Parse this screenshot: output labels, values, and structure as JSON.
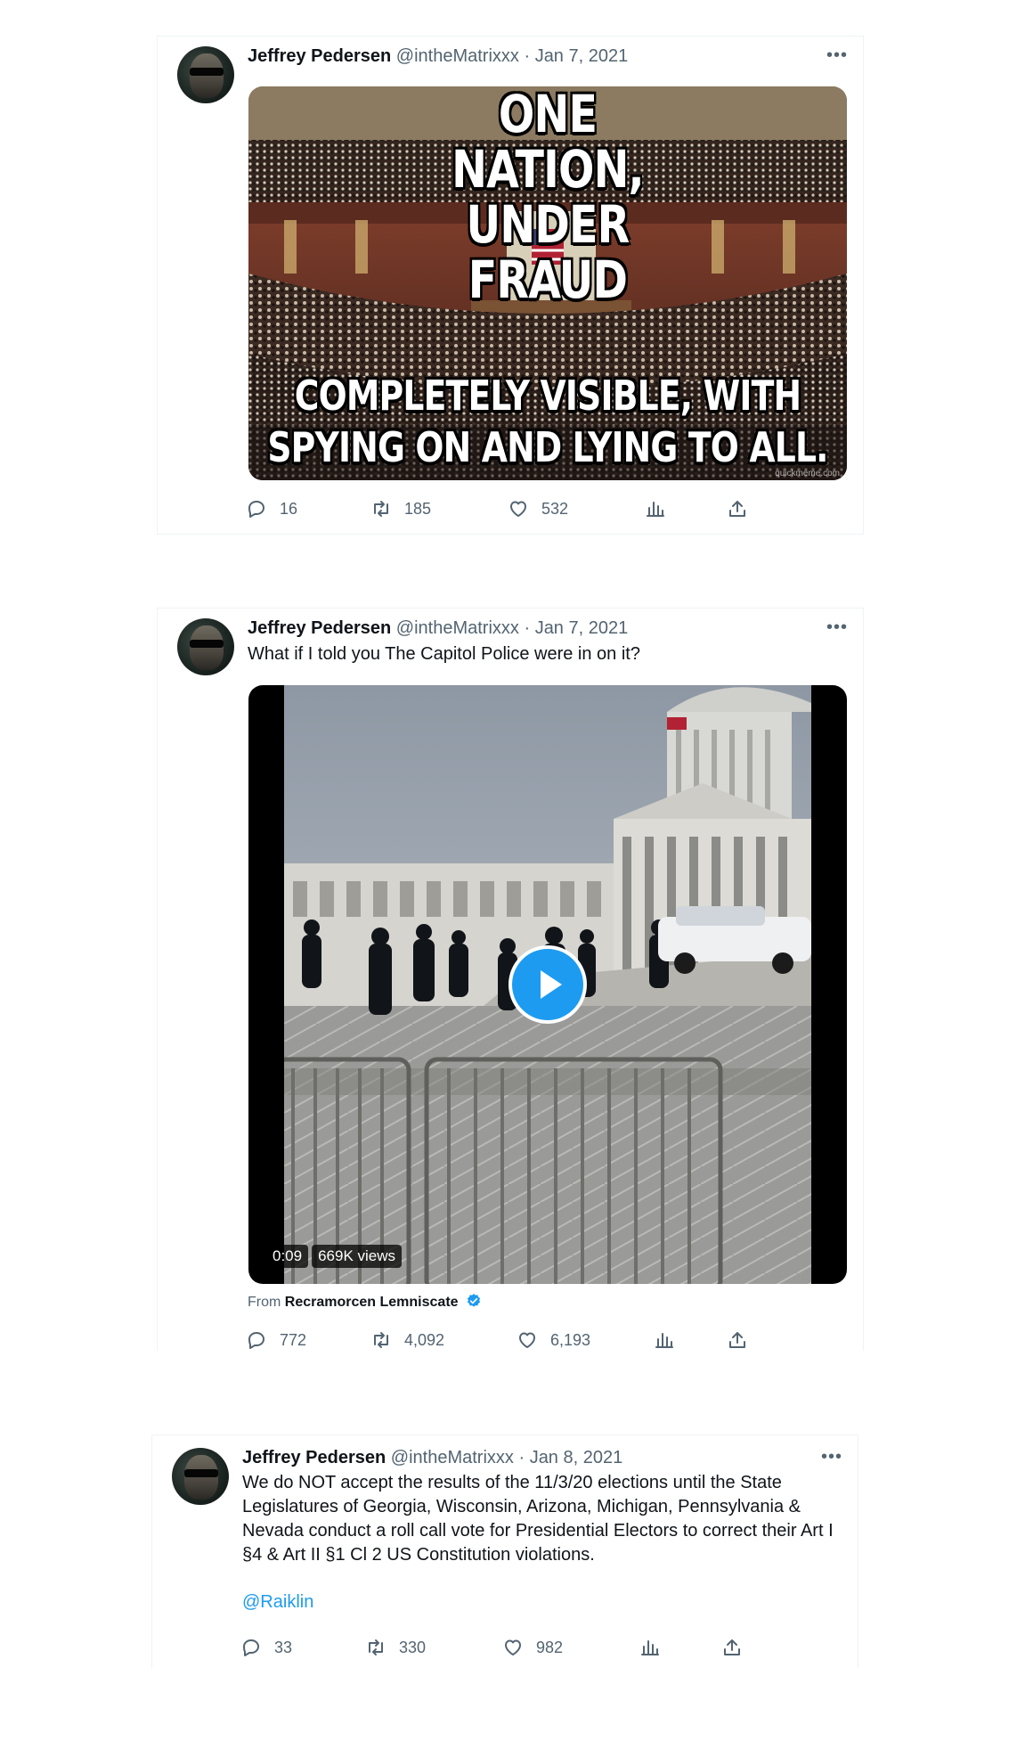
{
  "tweets": [
    {
      "name": "Jeffrey Pedersen",
      "handle": "@intheMatrixxx",
      "date": "Jan 7, 2021",
      "meme_top": "ONE NATION, UNDER FRAUD",
      "meme_bottom": "COMPLETELY VISIBLE, WITH SPYING ON AND LYING TO ALL.",
      "watermark": "quickmeme.com",
      "replies": "16",
      "retweets": "185",
      "likes": "532"
    },
    {
      "name": "Jeffrey Pedersen",
      "handle": "@intheMatrixxx",
      "date": "Jan 7, 2021",
      "text": "What if I told you The Capitol Police were in on it?",
      "video_time": "0:09",
      "video_views": "669K views",
      "from_label": "From",
      "from_name": "Recramorcen Lemniscate",
      "replies": "772",
      "retweets": "4,092",
      "likes": "6,193"
    },
    {
      "name": "Jeffrey Pedersen",
      "handle": "@intheMatrixxx",
      "date": "Jan 8, 2021",
      "text": "We do NOT accept the results of the 11/3/20 elections until the State Legislatures of Georgia, Wisconsin, Arizona, Michigan, Pennsylvania & Nevada conduct a roll call vote for Presidential Electors to correct their Art I §4 & Art II §1 Cl 2 US Constitution violations.",
      "mention": "@Raiklin",
      "replies": "33",
      "retweets": "330",
      "likes": "982"
    }
  ],
  "more_icon": "more-horizontal-icon",
  "colors": {
    "link": "#1d9bf0",
    "muted": "#536471",
    "text": "#0f1419"
  }
}
